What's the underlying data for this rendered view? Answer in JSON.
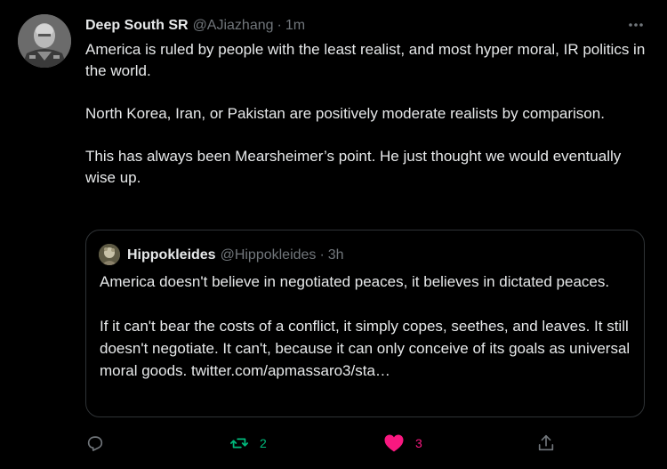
{
  "tweet": {
    "author": {
      "display_name": "Deep South SR",
      "handle": "@AJiazhang",
      "separator": "·",
      "time": "1m"
    },
    "paragraphs": [
      "America is ruled by people with the least realist, and most hyper moral, IR politics in the world.",
      "North Korea, Iran, or Pakistan are positively moderate realists by comparison.",
      "This has always been  Mearsheimer’s point. He just thought we would eventually wise up."
    ],
    "more_icon": "more-horizontal-icon"
  },
  "quoted_tweet": {
    "author": {
      "display_name": "Hippokleides",
      "handle": "@Hippokleides",
      "separator": "·",
      "time": "3h"
    },
    "paragraphs": [
      "America doesn't believe in negotiated peaces, it believes in dictated peaces.",
      "If it can't bear the costs of a conflict, it simply copes, seethes, and leaves. It still doesn't negotiate. It can't, because it can only conceive of its goals as universal moral goods. twitter.com/apmassaro3/sta…"
    ]
  },
  "actions": {
    "reply": {
      "icon": "reply-icon",
      "count": ""
    },
    "retweet": {
      "icon": "retweet-icon",
      "count": "2",
      "color": "#00ba7c"
    },
    "like": {
      "icon": "heart-icon",
      "count": "3",
      "color": "#f91880"
    },
    "share": {
      "icon": "share-icon"
    }
  },
  "colors": {
    "background": "#000000",
    "text": "#e7e9ea",
    "secondary": "#71767b",
    "border": "#2f3336"
  }
}
